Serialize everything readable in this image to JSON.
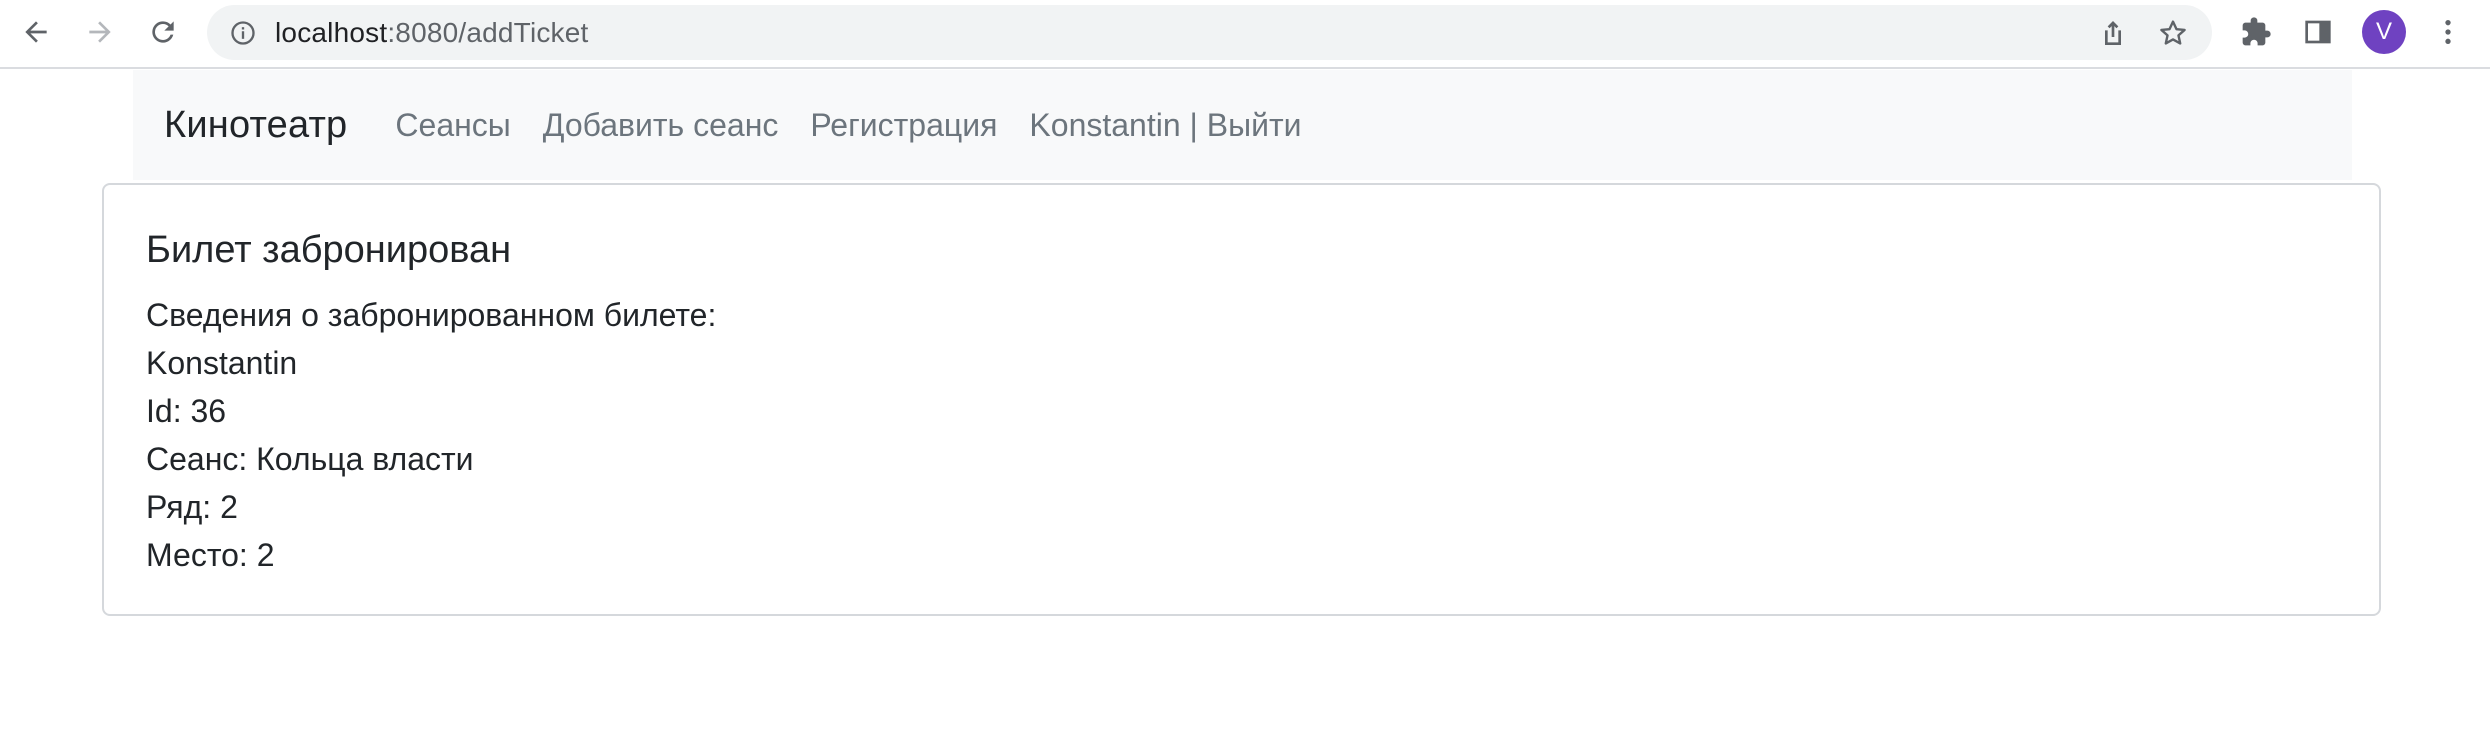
{
  "browser": {
    "url_host": "localhost",
    "url_path": ":8080/addTicket",
    "profile_initial": "V",
    "icons": [
      "back-arrow-icon",
      "forward-arrow-icon",
      "reload-icon",
      "info-icon",
      "share-icon",
      "star-icon",
      "extensions-icon",
      "side-panel-icon",
      "kebab-menu-icon"
    ]
  },
  "navbar": {
    "brand": "Кинотеатр",
    "links": [
      "Сеансы",
      "Добавить сеанс",
      "Регистрация",
      "Konstantin | Выйти"
    ]
  },
  "card": {
    "title": "Билет забронирован",
    "lines": [
      "Сведения о забронированном билете:",
      "Konstantin",
      "Id: 36",
      "Сеанс: Кольца власти",
      "Ряд: 2",
      "Место: 2"
    ]
  },
  "colors": {
    "navbar_bg": "#f8f9fa",
    "nav_link": "#6c757d",
    "avatar": "#6f42c1",
    "omnibox_bg": "#f1f3f4"
  }
}
